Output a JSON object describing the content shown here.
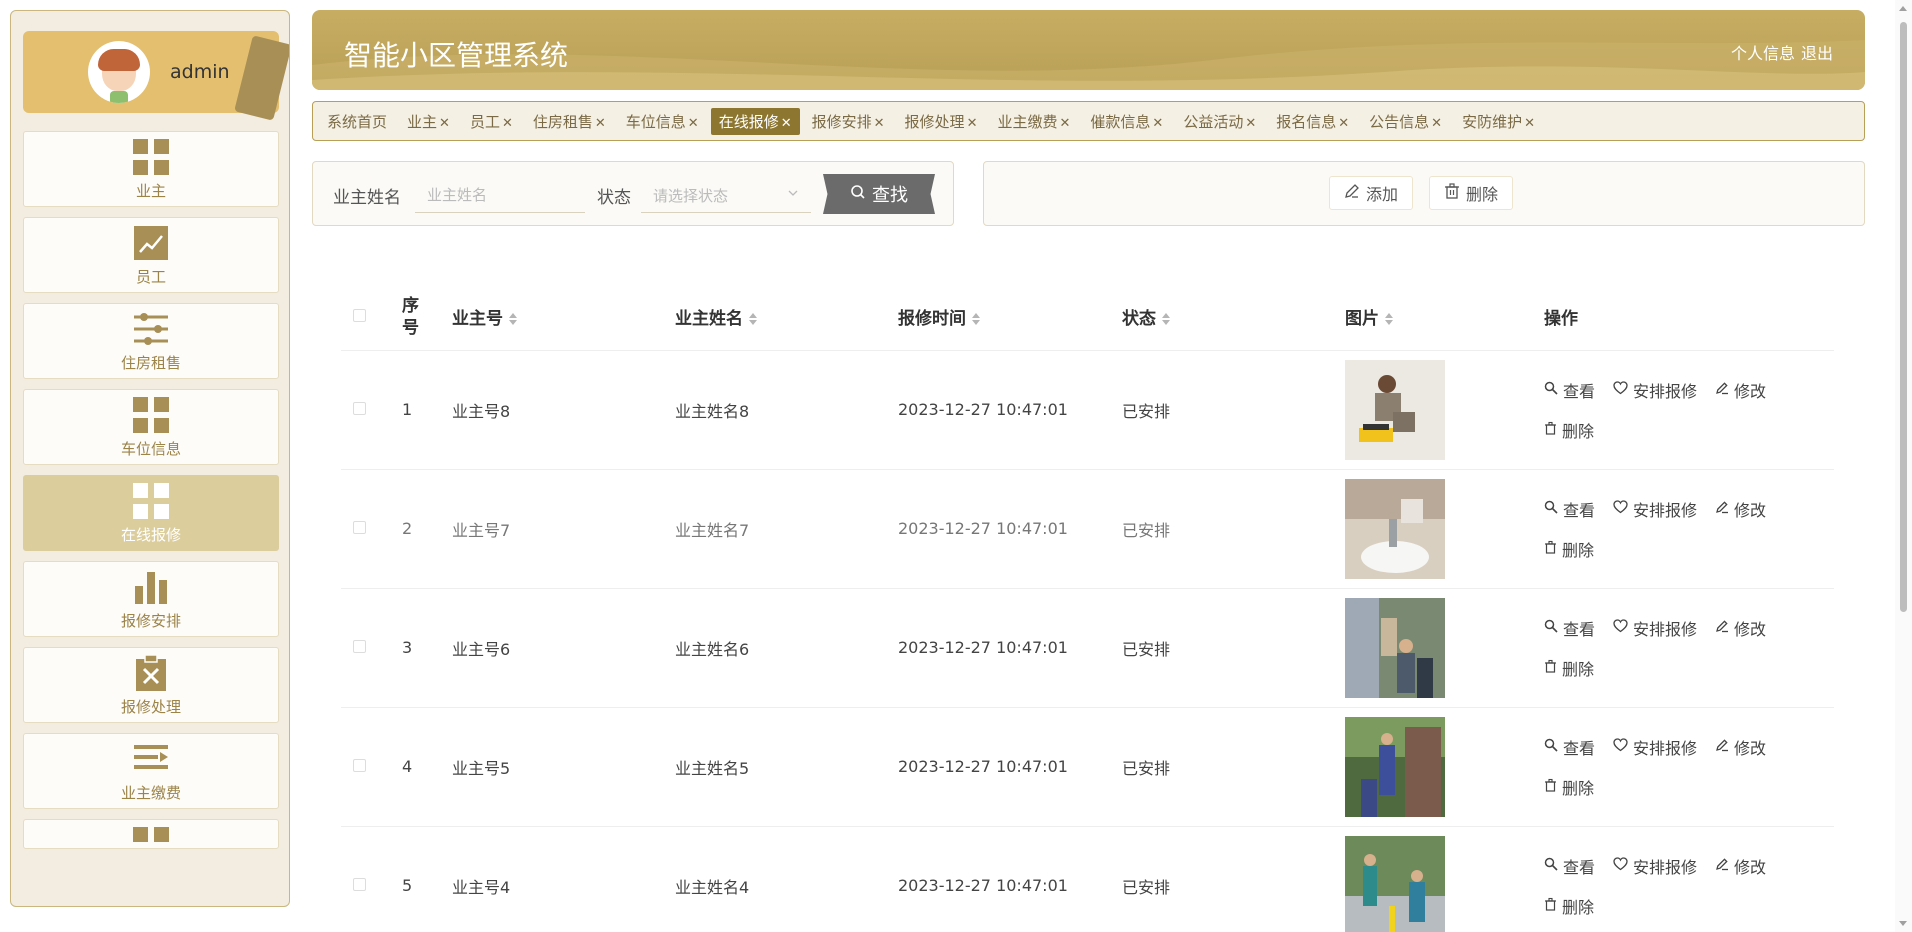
{
  "app": {
    "title": "智能小区管理系统"
  },
  "header": {
    "profile_link": "个人信息",
    "logout_link": "退出"
  },
  "user": {
    "name": "admin"
  },
  "sidebar": {
    "items": [
      {
        "label": "业主",
        "icon": "grid-icon"
      },
      {
        "label": "员工",
        "icon": "trend-chart-icon"
      },
      {
        "label": "住房租售",
        "icon": "sliders-icon"
      },
      {
        "label": "车位信息",
        "icon": "grid-icon"
      },
      {
        "label": "在线报修",
        "icon": "grid-icon",
        "active": true
      },
      {
        "label": "报修安排",
        "icon": "bar-chart-icon"
      },
      {
        "label": "报修处理",
        "icon": "clipboard-x-icon"
      },
      {
        "label": "业主缴费",
        "icon": "list-arrow-icon"
      }
    ]
  },
  "tabs": [
    {
      "label": "系统首页",
      "closable": false
    },
    {
      "label": "业主",
      "closable": true
    },
    {
      "label": "员工",
      "closable": true
    },
    {
      "label": "住房租售",
      "closable": true
    },
    {
      "label": "车位信息",
      "closable": true
    },
    {
      "label": "在线报修",
      "closable": true,
      "active": true
    },
    {
      "label": "报修安排",
      "closable": true
    },
    {
      "label": "报修处理",
      "closable": true
    },
    {
      "label": "业主缴费",
      "closable": true
    },
    {
      "label": "催款信息",
      "closable": true
    },
    {
      "label": "公益活动",
      "closable": true
    },
    {
      "label": "报名信息",
      "closable": true
    },
    {
      "label": "公告信息",
      "closable": true
    },
    {
      "label": "安防维护",
      "closable": true
    }
  ],
  "search": {
    "name_label": "业主姓名",
    "name_placeholder": "业主姓名",
    "status_label": "状态",
    "status_placeholder": "请选择状态",
    "button_label": "查找"
  },
  "actions": {
    "add_label": "添加",
    "delete_label": "删除"
  },
  "table": {
    "columns": {
      "index": "序号",
      "owner_no": "业主号",
      "owner_name": "业主姓名",
      "repair_time": "报修时间",
      "status": "状态",
      "image": "图片",
      "ops": "操作"
    },
    "op_labels": {
      "view": "查看",
      "arrange": "安排报修",
      "edit": "修改",
      "delete": "删除"
    },
    "rows": [
      {
        "index": "1",
        "owner_no": "业主号8",
        "owner_name": "业主姓名8",
        "repair_time": "2023-12-27 10:47:01",
        "status": "已安排"
      },
      {
        "index": "2",
        "owner_no": "业主号7",
        "owner_name": "业主姓名7",
        "repair_time": "2023-12-27 10:47:01",
        "status": "已安排"
      },
      {
        "index": "3",
        "owner_no": "业主号6",
        "owner_name": "业主姓名6",
        "repair_time": "2023-12-27 10:47:01",
        "status": "已安排"
      },
      {
        "index": "4",
        "owner_no": "业主号5",
        "owner_name": "业主姓名5",
        "repair_time": "2023-12-27 10:47:01",
        "status": "已安排"
      },
      {
        "index": "5",
        "owner_no": "业主号4",
        "owner_name": "业主姓名4",
        "repair_time": "2023-12-27 10:47:01",
        "status": "已安排"
      }
    ]
  },
  "colors": {
    "accent": "#b89f57",
    "active_tab": "#8d7630",
    "sidebar_active": "#dccd9c",
    "search_button": "#6b6b6b"
  }
}
